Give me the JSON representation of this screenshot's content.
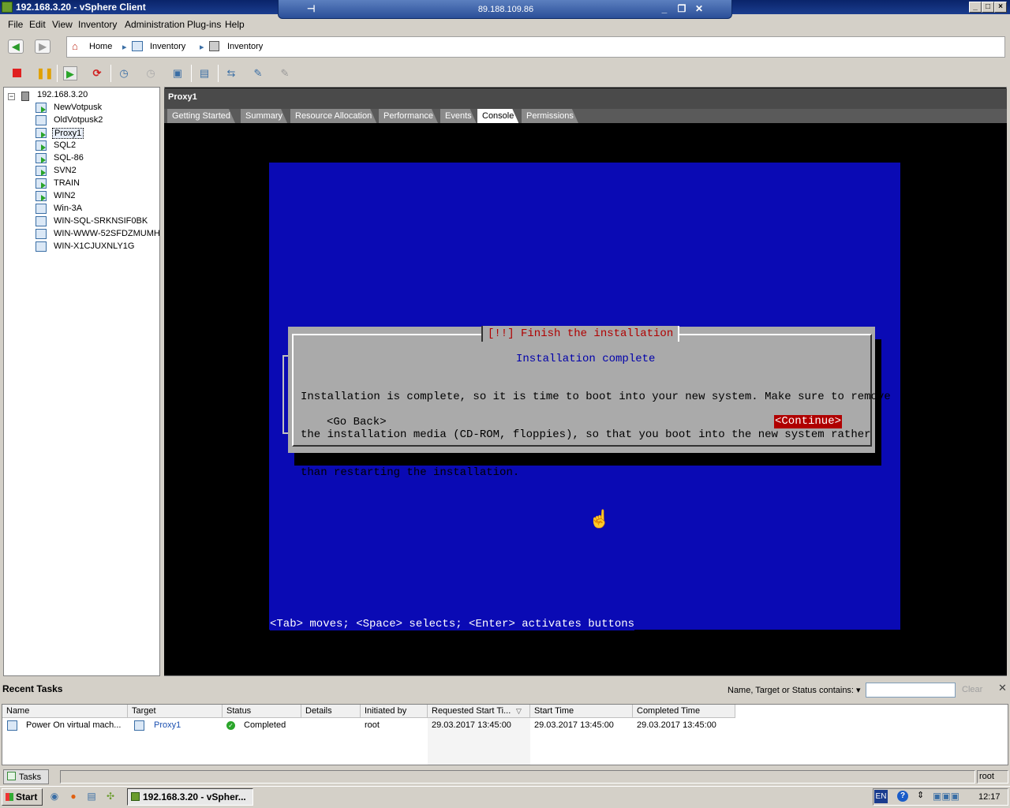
{
  "window": {
    "title": "192.168.3.20 - vSphere Client",
    "min": "_",
    "max": "□",
    "close": "×"
  },
  "rdp": {
    "address": "89.188.109.86",
    "pin": "⊣",
    "min": "_",
    "restore": "❐",
    "close": "✕"
  },
  "menu": [
    "File",
    "Edit",
    "View",
    "Inventory",
    "Administration",
    "Plug-ins",
    "Help"
  ],
  "breadcrumb": {
    "home": "Home",
    "inventory1": "Inventory",
    "inventory2": "Inventory"
  },
  "tree": {
    "host": "192.168.3.20",
    "vms": [
      "NewVotpusk",
      "OldVotpusk2",
      "Proxy1",
      "SQL2",
      "SQL-86",
      "SVN2",
      "TRAIN",
      "WIN2",
      "Win-3A",
      "WIN-SQL-SRKNSIF0BK",
      "WIN-WWW-52SFDZMUMH",
      "WIN-X1CJUXNLY1G"
    ],
    "powered_on": [
      "NewVotpusk",
      "Proxy1",
      "SQL2",
      "SQL-86",
      "SVN2",
      "TRAIN",
      "WIN2"
    ],
    "selected": "Proxy1"
  },
  "main": {
    "vm_title": "Proxy1",
    "tabs": [
      "Getting Started",
      "Summary",
      "Resource Allocation",
      "Performance",
      "Events",
      "Console",
      "Permissions"
    ],
    "active_tab": "Console"
  },
  "console": {
    "dialog_title": "[!!] Finish the installation",
    "subtitle": "Installation complete",
    "body_lines": [
      "Installation is complete, so it is time to boot into your new system. Make sure to remove",
      "the installation media (CD-ROM, floppies), so that you boot into the new system rather",
      "than restarting the installation."
    ],
    "go_back": "<Go Back>",
    "continue": "<Continue>",
    "hint": "<Tab> moves; <Space> selects; <Enter> activates buttons"
  },
  "recent_tasks": {
    "label": "Recent Tasks",
    "filter_label": "Name, Target or Status contains: ▾",
    "filter_value": "",
    "clear": "Clear",
    "close": "✕",
    "columns": [
      "Name",
      "Target",
      "Status",
      "Details",
      "Initiated by",
      "Requested Start Ti...",
      "Start Time",
      "Completed Time"
    ],
    "rows": [
      {
        "name": "Power On virtual mach...",
        "target": "Proxy1",
        "status": "Completed",
        "details": "",
        "initiated_by": "root",
        "requested": "29.03.2017 13:45:00",
        "start": "29.03.2017 13:45:00",
        "completed": "29.03.2017 13:45:00"
      }
    ]
  },
  "statusbar": {
    "tasks": "Tasks",
    "user": "root"
  },
  "taskbar": {
    "start": "Start",
    "item": "192.168.3.20 - vSpher...",
    "lang": "EN",
    "clock": "12:17"
  },
  "colors": {
    "console_bg": "#0a0ab4",
    "dialog_bg": "#aaaaaa",
    "accent_red": "#b00000",
    "title_blue": "#0a246a"
  }
}
